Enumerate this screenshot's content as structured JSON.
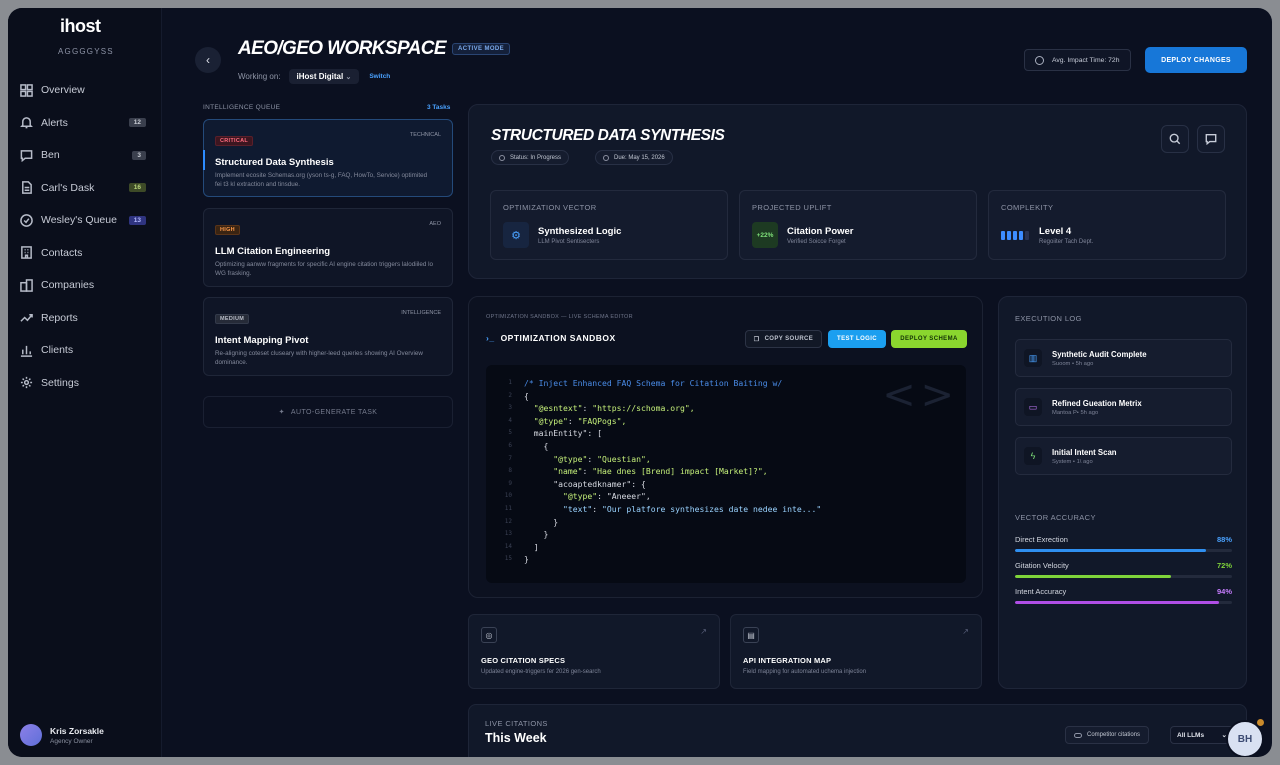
{
  "app": {
    "logo": "ihost",
    "tenant": "AGGGGYSS"
  },
  "sidebar": {
    "items": [
      {
        "label": "Overview",
        "icon": "grid-icon"
      },
      {
        "label": "Alerts",
        "icon": "bell-icon",
        "badge": "12"
      },
      {
        "label": "Ben",
        "icon": "chat-icon",
        "badge": "3"
      },
      {
        "label": "Carl's Dask",
        "icon": "file-icon",
        "badge": "16"
      },
      {
        "label": "Wesley's Queue",
        "icon": "check-circle-icon",
        "badge": "13"
      },
      {
        "label": "Contacts",
        "icon": "building-icon"
      },
      {
        "label": "Companies",
        "icon": "buildings-icon"
      },
      {
        "label": "Reports",
        "icon": "trend-icon"
      },
      {
        "label": "Clients",
        "icon": "bar-chart-icon"
      },
      {
        "label": "Settings",
        "icon": "gear-icon"
      }
    ],
    "user": {
      "name": "Kris Zorsakle",
      "role": "Agency Owner"
    }
  },
  "header": {
    "title": "AEO/GEO WORKSPACE",
    "mode_badge": "ACTIVE MODE",
    "working_label": "Working on:",
    "workspace": "iHost Digital",
    "switch_label": "Switch",
    "impact": "Avg. Impact Time: 72h",
    "deploy_label": "DEPLOY CHANGES"
  },
  "queue": {
    "title": "INTELLIGENCE QUEUE",
    "count": "3 Tasks",
    "tasks": [
      {
        "tag": "CRITICAL",
        "category": "TECHNICAL",
        "name": "Structured Data Synthesis",
        "desc": "Implement ecosite Schemas.org (yson ts-g, FAQ, HowTo, Service) optimited fei t3 kl extraction and tinsdue."
      },
      {
        "tag": "HIGH",
        "category": "AEO",
        "name": "LLM Citation Engineering",
        "desc": "Optimizing aanww fragments for specific AI engine citation triggers lalodiiled lo WG frasking."
      },
      {
        "tag": "MEDIUM",
        "category": "INTELLIGENCE",
        "name": "Intent Mapping Pivot",
        "desc": "Re-aligning coteset cluseary with higher-leed queries showing AI Overview dominance."
      }
    ],
    "auto_label": "AUTO-GENERATE TASK"
  },
  "detail": {
    "title": "STRUCTURED DATA SYNTHESIS",
    "status": "Status: In Progress",
    "due": "Due: May 15, 2026",
    "metrics": [
      {
        "label": "OPTIMIZATION VECTOR",
        "value": "Synthesized Logic",
        "sub": "LLM Pivot Sentisecters",
        "icon": "gear-icon"
      },
      {
        "label": "PROJECTED UPLIFT",
        "value": "Citation Power",
        "sub": "Verified Soicce Forget",
        "badge": "+22%"
      },
      {
        "label": "COMPLEKITY",
        "value": "Level 4",
        "sub": "Regoiiter Tach Dept.",
        "level": 4
      }
    ]
  },
  "sandbox": {
    "crumb": "OPTIMIZATION SANDBOX — LIVE SCHEMA EDITOR",
    "title": "OPTIMIZATION SANDBOX",
    "copy_label": "COPY SOURCE",
    "test_label": "TEST LOGIC",
    "deploy_label": "DEPLOY SCHEMA",
    "code": [
      {
        "n": "1",
        "t": "/* Inject Enhanced FAQ Schema for Citation Baiting w/",
        "c": "cc",
        "indent": 0
      },
      {
        "n": "2",
        "t": "{",
        "c": "tx",
        "indent": 0
      },
      {
        "n": "3",
        "k": "\"@esntext\"",
        "v": "\"https://schoma.org\",",
        "indent": 1
      },
      {
        "n": "4",
        "k": "\"@type\"",
        "v": "\"FAQPogs\",",
        "indent": 1
      },
      {
        "n": "5",
        "t": "mainEntity\": [",
        "c": "tx",
        "indent": 1
      },
      {
        "n": "6",
        "t": "{",
        "c": "tx",
        "indent": 2
      },
      {
        "n": "7",
        "k": "\"@type\"",
        "v": "\"Questian\",",
        "indent": 3
      },
      {
        "n": "8",
        "k": "\"name\"",
        "v": "\"Hae dnes [Brend] impact [Market]?\",",
        "indent": 3
      },
      {
        "n": "9",
        "t": "\"acoaptedknamer\": {",
        "c": "tx",
        "indent": 3
      },
      {
        "n": "10",
        "k": "\"@type\"",
        "v": "\"Aneeer\",",
        "indent": 4,
        "vc": "tx"
      },
      {
        "n": "11",
        "k": "\"text\"",
        "v": "\"Our platfore synthesizes date nedee inte...\"",
        "indent": 4,
        "kc": "cv",
        "vc": "cv"
      },
      {
        "n": "12",
        "t": "}",
        "c": "tx",
        "indent": 3
      },
      {
        "n": "13",
        "t": "}",
        "c": "tx",
        "indent": 2
      },
      {
        "n": "14",
        "t": "]",
        "c": "tx",
        "indent": 1
      },
      {
        "n": "15",
        "t": "}",
        "c": "tx",
        "indent": 0
      }
    ]
  },
  "log": {
    "title": "EXECUTION LOG",
    "items": [
      {
        "name": "Synthetic Audit Complete",
        "meta": "Suoom • 5h ago",
        "icon": "bar-chart-icon",
        "color": "#4aa2ff"
      },
      {
        "name": "Refined Gueation Metrix",
        "meta": "Mantoa P• 5h ago",
        "icon": "chat-icon",
        "color": "#c77dff"
      },
      {
        "name": "Initial Intent Scan",
        "meta": "System • 1\\ ago",
        "icon": "bolt-icon",
        "color": "#7fe07a"
      }
    ]
  },
  "accuracy": {
    "title": "VECTOR ACCURACY",
    "items": [
      {
        "label": "Direct Exrection",
        "pct": "88%",
        "value": 88,
        "color": "#2f8ff0"
      },
      {
        "label": "Gitation Velocity",
        "pct": "72%",
        "value": 72,
        "color": "#7fd43a"
      },
      {
        "label": "Intent Accuracy",
        "pct": "94%",
        "value": 94,
        "color": "#b04ee6"
      }
    ]
  },
  "cards": [
    {
      "title": "GEO CITATION SPECS",
      "desc": "Updated engine-triggers fer 2026 gen-search",
      "icon": "globe-icon"
    },
    {
      "title": "API INTEGRATION MAP",
      "desc": "Field mapping for automated uchema injection",
      "icon": "database-icon"
    }
  ],
  "live": {
    "label": "LIVE CITATIONS",
    "title": "This Week",
    "competitor_label": "Competitor citations",
    "llm_select": "All LLMs"
  },
  "fab": {
    "initials": "BH"
  }
}
